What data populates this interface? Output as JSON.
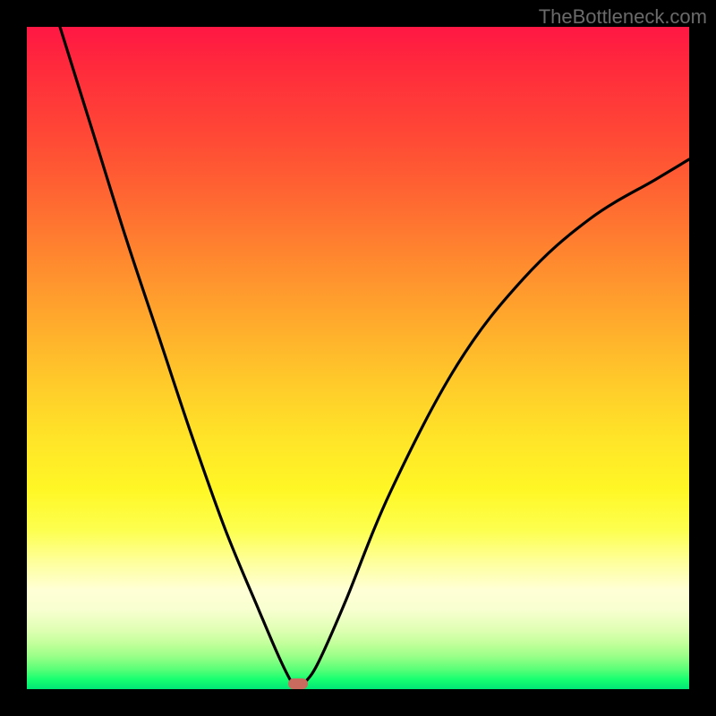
{
  "watermark": "TheBottleneck.com",
  "chart_data": {
    "type": "line",
    "title": "",
    "xlabel": "",
    "ylabel": "",
    "xlim": [
      0,
      100
    ],
    "ylim": [
      0,
      100
    ],
    "background_gradient": {
      "top_color": "#ff1744",
      "mid_color": "#ffeb3b",
      "bottom_color": "#00e676"
    },
    "series": [
      {
        "name": "bottleneck-curve",
        "x": [
          5,
          10,
          15,
          20,
          25,
          30,
          35,
          38,
          40,
          41,
          42,
          44,
          48,
          55,
          65,
          75,
          85,
          95,
          100
        ],
        "values": [
          100,
          84,
          68,
          53,
          38,
          24,
          12,
          5,
          1,
          0,
          1,
          4,
          13,
          30,
          49,
          62,
          71,
          77,
          80
        ]
      }
    ],
    "annotations": [
      {
        "name": "min-marker",
        "x": 41,
        "y": 0.8,
        "color": "#c96a5f"
      }
    ]
  }
}
